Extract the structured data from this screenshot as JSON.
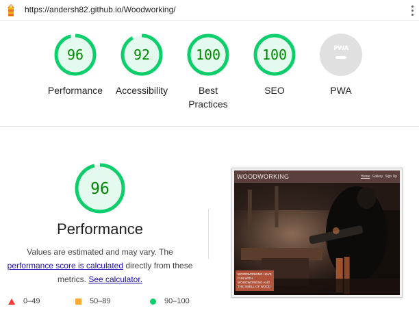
{
  "browser": {
    "url": "https://andersh82.github.io/Woodworking/"
  },
  "summary": {
    "gauges": [
      {
        "key": "performance",
        "score": "96",
        "label": "Performance",
        "status": "pass"
      },
      {
        "key": "accessibility",
        "score": "92",
        "label": "Accessibility",
        "status": "pass"
      },
      {
        "key": "best-practices",
        "score": "100",
        "label": "Best\nPractices",
        "status": "pass"
      },
      {
        "key": "seo",
        "score": "100",
        "label": "SEO",
        "status": "pass"
      },
      {
        "key": "pwa",
        "score": "",
        "label": "PWA",
        "status": "na",
        "badge": "PWA"
      }
    ]
  },
  "performance": {
    "score": "96",
    "title": "Performance",
    "desc_pre": "Values are estimated and may vary. The ",
    "desc_link": "performance score is calculated",
    "desc_mid": " directly from these metrics. ",
    "desc_link2": "See calculator."
  },
  "legend": [
    {
      "shape": "triangle",
      "label": "0–49",
      "color": "#ff3333"
    },
    {
      "shape": "square",
      "label": "50–89",
      "color": "#ffaa33"
    },
    {
      "shape": "circle",
      "label": "90–100",
      "color": "#0cce6b"
    }
  ],
  "thumbnail": {
    "brand": "WOODWORKING",
    "nav": [
      "Home",
      "Gallery",
      "Sign Up"
    ],
    "caption": "WOODWORKING HAVE FUN WITH WOODWORKING AND THE SMELL OF WOOD"
  },
  "colors": {
    "pass_stroke": "#0cce6b",
    "pass_fill": "#e5faef",
    "pass_text": "#008800",
    "na_fill": "#e0e0e0"
  }
}
